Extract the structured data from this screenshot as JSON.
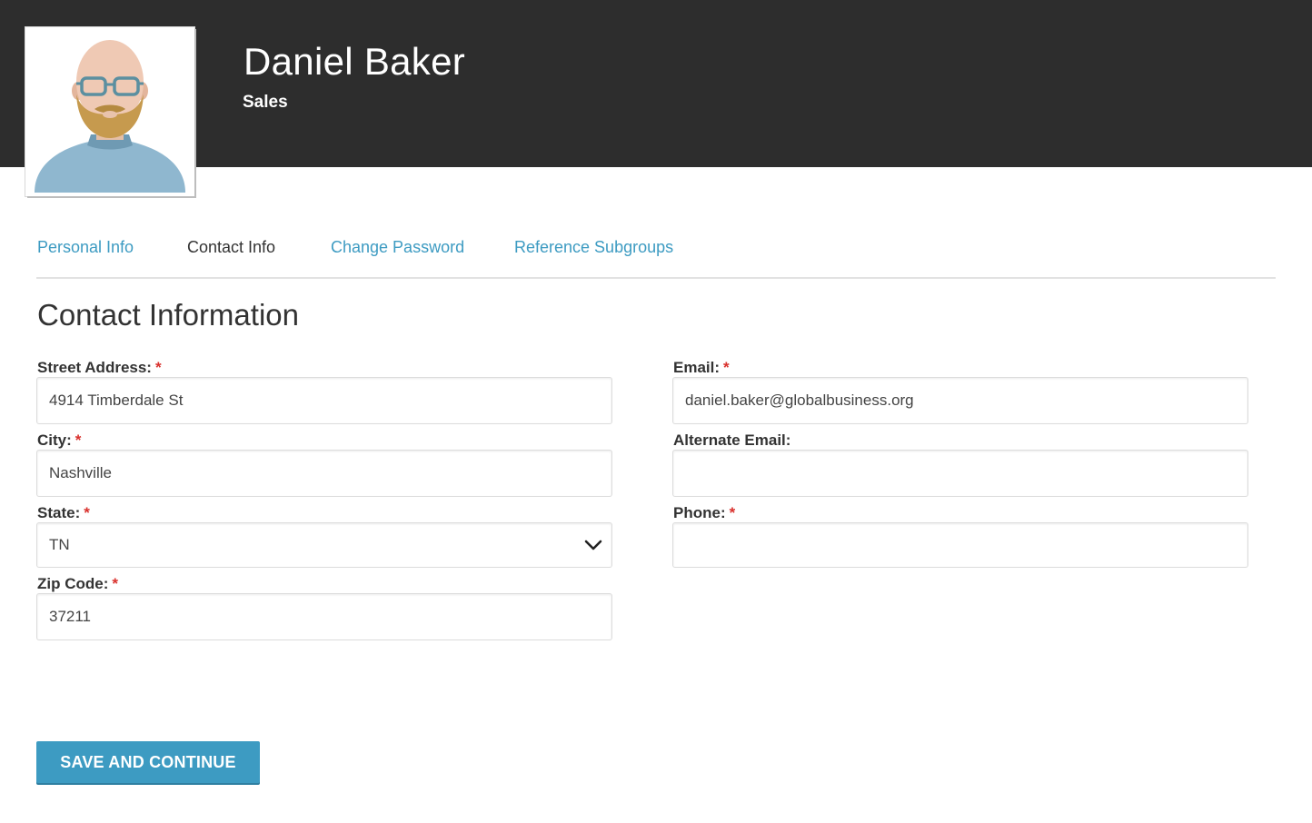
{
  "profile": {
    "name": "Daniel Baker",
    "department": "Sales",
    "avatar_icon": "bald-bearded-man-glasses-avatar"
  },
  "tabs": [
    {
      "label": "Personal Info",
      "active": false
    },
    {
      "label": "Contact Info",
      "active": true
    },
    {
      "label": "Change Password",
      "active": false
    },
    {
      "label": "Reference Subgroups",
      "active": false
    }
  ],
  "section": {
    "title": "Contact Information"
  },
  "fields": {
    "street": {
      "label": "Street Address:",
      "value": "4914 Timberdale St",
      "required": true
    },
    "city": {
      "label": "City:",
      "value": "Nashville",
      "required": true
    },
    "state": {
      "label": "State:",
      "value": "TN",
      "required": true
    },
    "zip": {
      "label": "Zip Code:",
      "value": "37211",
      "required": true
    },
    "email": {
      "label": "Email:",
      "value": "daniel.baker@globalbusiness.org",
      "required": true
    },
    "alt_email": {
      "label": "Alternate Email:",
      "value": "",
      "required": false
    },
    "phone": {
      "label": "Phone:",
      "value": "",
      "required": true
    }
  },
  "required_marker": "*",
  "actions": {
    "save_label": "SAVE AND CONTINUE"
  },
  "colors": {
    "header_bg": "#2d2d2d",
    "accent": "#3d9bc2",
    "required": "#d9302c"
  }
}
